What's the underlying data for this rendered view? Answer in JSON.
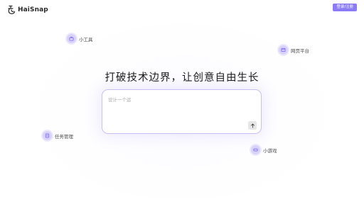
{
  "header": {
    "logo_text": "HaiSnap",
    "logo_icon": "haisnap-logo-icon",
    "login_label": "登录/注册"
  },
  "features": {
    "tools": {
      "label": "小工具",
      "icon": "toolbox-icon"
    },
    "web": {
      "label": "网页平台",
      "icon": "web-page-icon"
    },
    "tasks": {
      "label": "任务管理",
      "icon": "task-list-icon"
    },
    "games": {
      "label": "小游戏",
      "icon": "gamepad-icon"
    }
  },
  "main": {
    "headline": "打破技术边界，让创意自由生长",
    "prompt_placeholder": "设计一个运",
    "send_icon": "arrow-up-icon"
  },
  "colors": {
    "accent": "#8b7cf6",
    "chip_bg": "#d9d3fb",
    "card_border": "#c9bff5",
    "send_bg": "#e6e6e6"
  }
}
